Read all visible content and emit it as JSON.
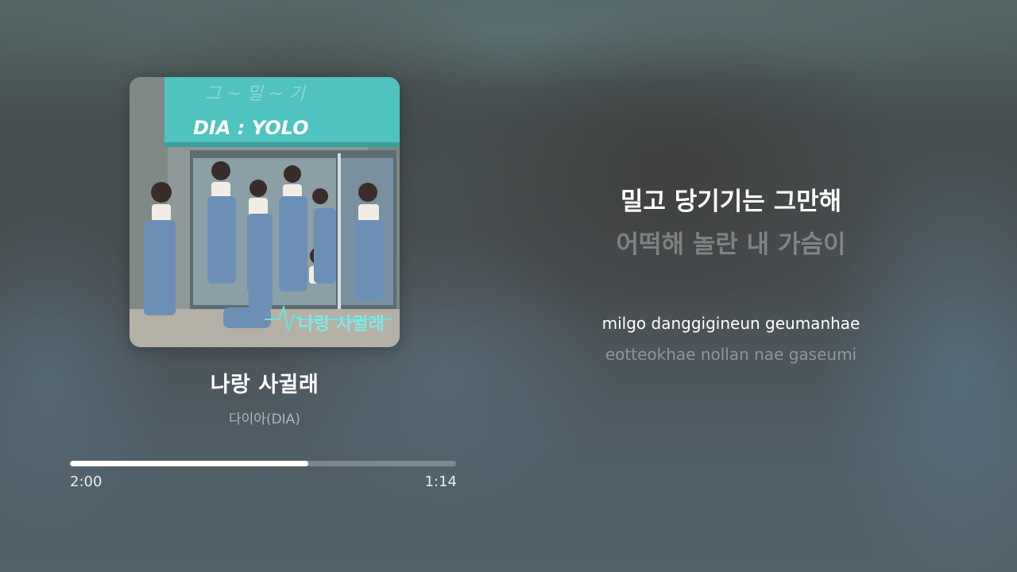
{
  "now_playing": {
    "title": "나랑 사귈래",
    "artist": "다이아(DIA)",
    "album_art": {
      "sign_text": "DIA : YOLO",
      "cover_title": "나랑 사귈래",
      "sign_color": "#4fc3c0"
    }
  },
  "progress": {
    "elapsed": "2:00",
    "remaining": "1:14",
    "fraction": 0.618
  },
  "lyrics": {
    "current": "밀고 당기기는 그만해",
    "next": "어떡해 놀란 내 가슴이",
    "romanization_current": "milgo danggigineun geumanhae",
    "romanization_next": "eotteokhae nollan nae gaseumi"
  }
}
